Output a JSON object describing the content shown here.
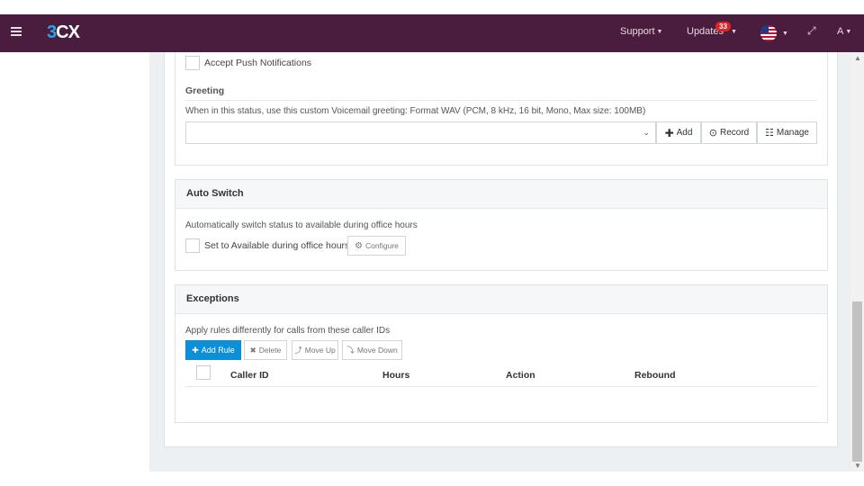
{
  "header": {
    "logo": {
      "prefix": "3",
      "suffix": "CX"
    },
    "support_label": "Support",
    "updates_label": "Updates",
    "updates_badge": "33",
    "user_label": "A"
  },
  "push": {
    "label": "Accept Push Notifications"
  },
  "greeting": {
    "title": "Greeting",
    "help": "When in this status, use this custom Voicemail greeting: Format WAV (PCM, 8 kHz, 16 bit, Mono, Max size: 100MB)",
    "select_value": "",
    "add_label": "Add",
    "record_label": "Record",
    "manage_label": "Manage"
  },
  "auto_switch": {
    "title": "Auto Switch",
    "help": "Automatically switch status to available during office hours",
    "checkbox_label": "Set to Available during office hours",
    "configure_label": "Configure"
  },
  "exceptions": {
    "title": "Exceptions",
    "help": "Apply rules differently for calls from these caller IDs",
    "buttons": {
      "add_rule": "Add Rule",
      "delete": "Delete",
      "move_up": "Move Up",
      "move_down": "Move Down"
    },
    "columns": [
      "Caller ID",
      "Hours",
      "Action",
      "Rebound"
    ],
    "rows": []
  },
  "colors": {
    "topbar": "#4a1d3f",
    "primary": "#0d8fd8",
    "badge": "#e02424"
  }
}
